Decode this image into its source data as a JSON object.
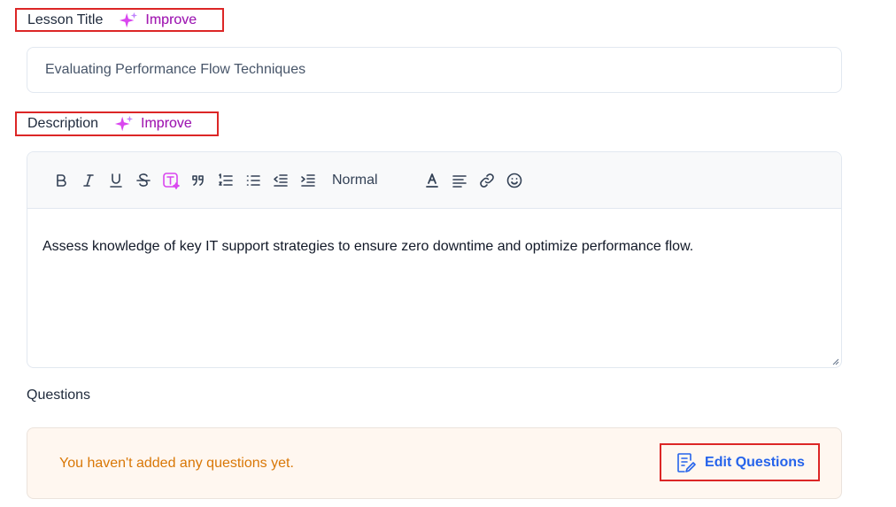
{
  "lesson_title": {
    "label": "Lesson Title",
    "improve_label": "Improve",
    "value": "Evaluating Performance Flow Techniques"
  },
  "description": {
    "label": "Description",
    "improve_label": "Improve",
    "toolbar": {
      "buttons": [
        "bold-icon",
        "italic-icon",
        "underline-icon",
        "strikethrough-icon",
        "ai-text-icon",
        "quote-icon",
        "ordered-list-icon",
        "bullet-list-icon",
        "outdent-icon",
        "indent-icon",
        "text-color-icon",
        "align-icon",
        "link-icon",
        "emoji-icon"
      ],
      "format_value": "Normal"
    },
    "content": "Assess knowledge of key IT support strategies to ensure zero downtime and optimize performance flow."
  },
  "questions": {
    "heading": "Questions",
    "empty_message": "You haven't added any questions yet.",
    "edit_label": "Edit Questions"
  },
  "colors": {
    "accent": "#2563eb",
    "improve": "#c026d3",
    "warning_text": "#d97706",
    "highlight_border": "#dc2626"
  }
}
